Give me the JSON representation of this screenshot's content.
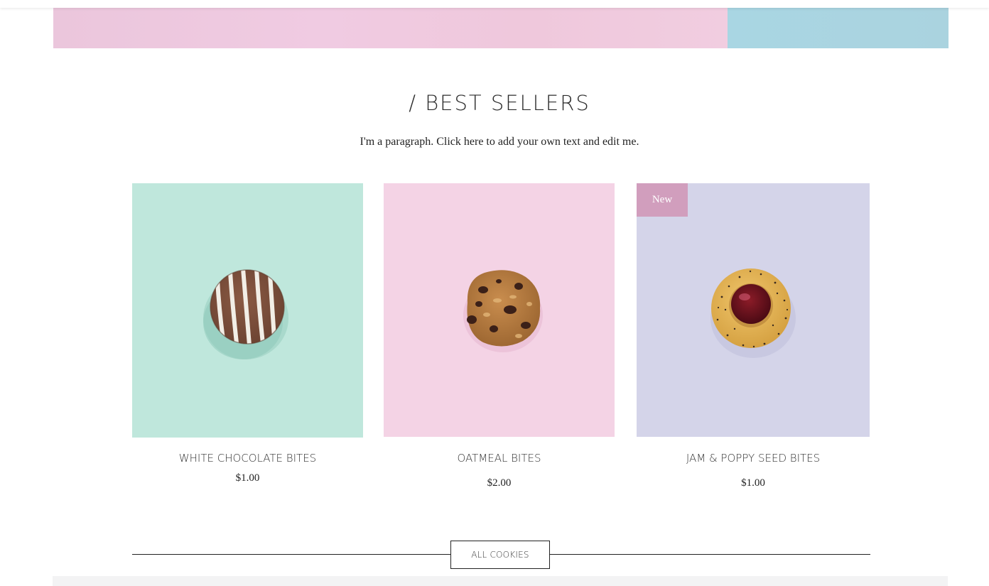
{
  "section": {
    "title": "/ BEST SELLERS",
    "paragraph": "I'm a paragraph. Click here to add your own text and edit me."
  },
  "products": [
    {
      "name": "WHITE CHOCOLATE BITES",
      "price": "$1.00",
      "background": "#bfe7dc",
      "image": "white-chocolate-stripe-cookie"
    },
    {
      "name": "OATMEAL BITES",
      "price": "$2.00",
      "background": "#f4d3e5",
      "image": "oatmeal-raisin-cookie"
    },
    {
      "name": "JAM & POPPY SEED BITES",
      "price": "$1.00",
      "background": "#d4d4e9",
      "badge": "New",
      "badge_color": "#d19ebd",
      "image": "jam-poppy-seed-cookie"
    }
  ],
  "all_cookies_button": "ALL COOKIES",
  "colors": {
    "hero_pink": "#efc8dd",
    "hero_blue": "#aad5e2"
  }
}
